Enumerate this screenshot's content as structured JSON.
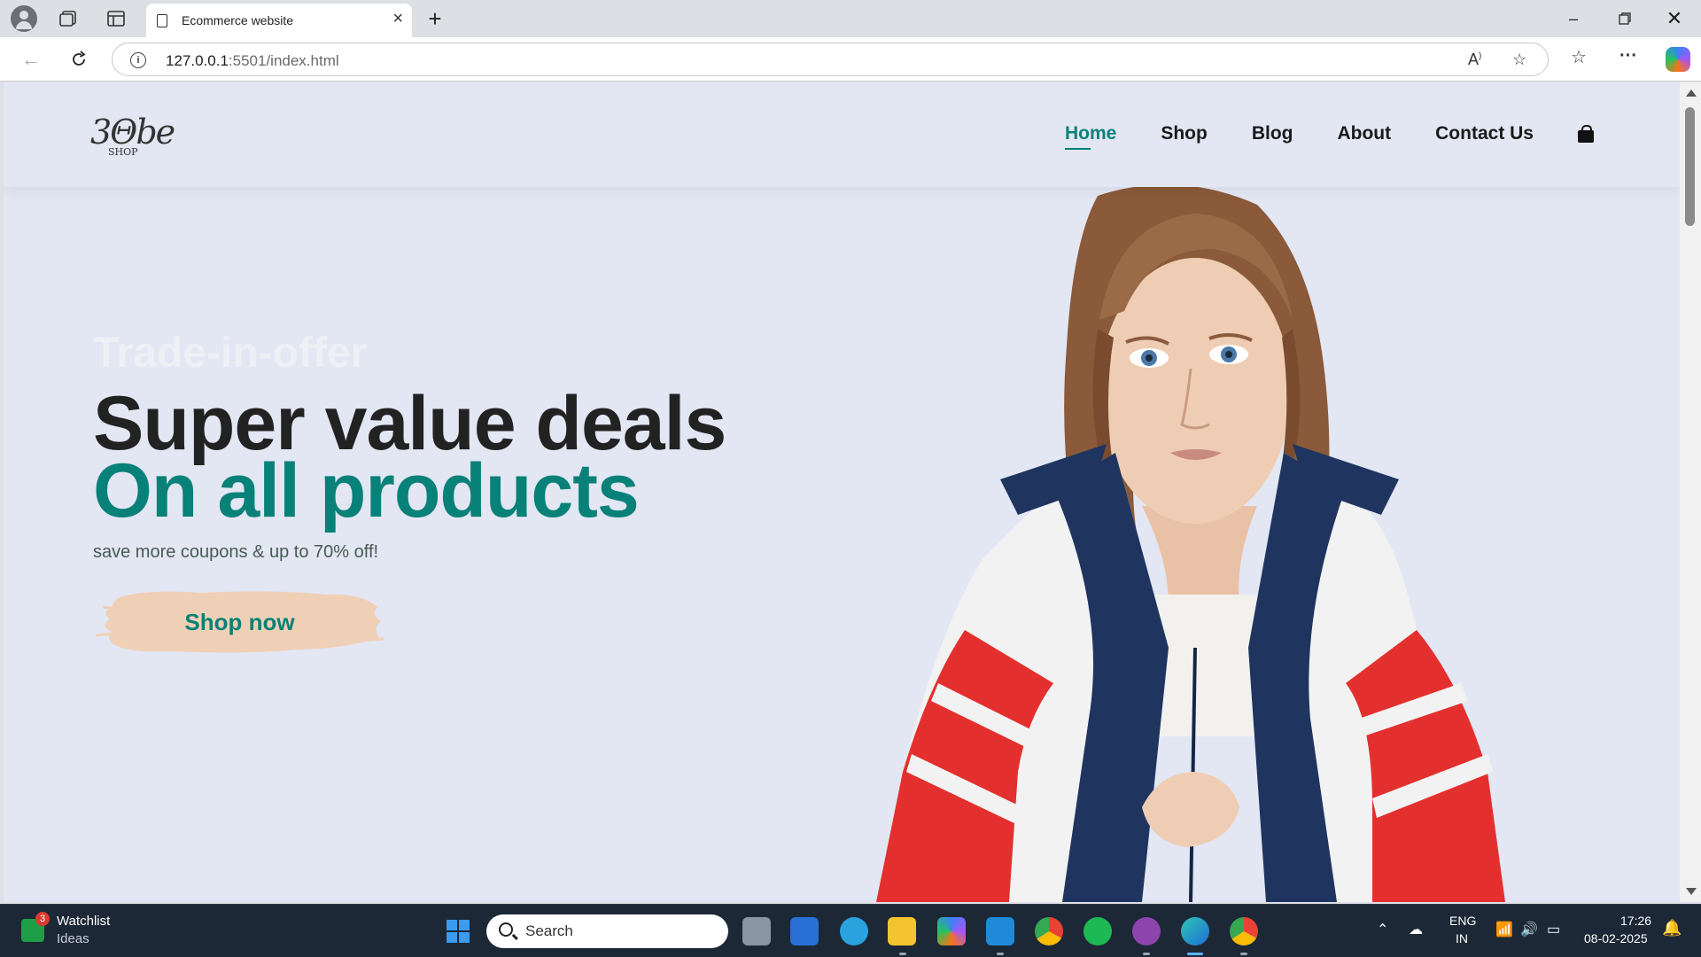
{
  "browser": {
    "tab_title": "Ecommerce website",
    "url_host": "127.0.0.1",
    "url_rest": ":5501/index.html"
  },
  "site": {
    "logo_text": "3Θbe",
    "logo_sub": "SHOP",
    "nav": [
      {
        "label": "Home",
        "active": true
      },
      {
        "label": "Shop"
      },
      {
        "label": "Blog"
      },
      {
        "label": "About"
      },
      {
        "label": "Contact Us"
      }
    ]
  },
  "hero": {
    "eyebrow": "Trade-in-offer",
    "headline": "Super value deals",
    "headline_accent": "On all products",
    "subtext": "save more coupons & up to 70% off!",
    "cta": "Shop now"
  },
  "colors": {
    "accent": "#088178",
    "page_bg": "#e3e6f3",
    "brush": "#efd0b6"
  },
  "taskbar": {
    "widget_title": "Watchlist",
    "widget_sub": "Ideas",
    "widget_badge": "3",
    "search_label": "Search",
    "lang": "ENG",
    "region": "IN",
    "time": "17:26",
    "date": "08-02-2025"
  }
}
